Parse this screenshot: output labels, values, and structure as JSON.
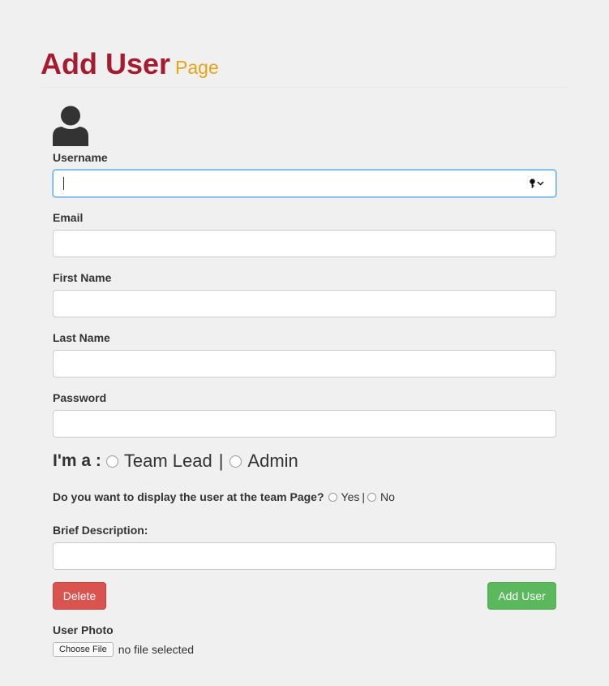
{
  "page": {
    "title_main": "Add User",
    "title_sub": "Page"
  },
  "form": {
    "username_label": "Username",
    "username_value": "",
    "email_label": "Email",
    "email_value": "",
    "firstname_label": "First Name",
    "firstname_value": "",
    "lastname_label": "Last Name",
    "lastname_value": "",
    "password_label": "Password",
    "password_value": "",
    "role_prompt": "I'm a :",
    "role_options": [
      "Team Lead",
      "Admin"
    ],
    "role_separator": "|",
    "display_prompt": "Do you want to display the user at the team Page?",
    "display_options": [
      "Yes",
      "No"
    ],
    "display_separator": "|",
    "description_label": "Brief Description:",
    "description_value": "",
    "delete_label": "Delete",
    "add_label": "Add User",
    "photo_label": "User Photo",
    "choose_file_label": "Choose File",
    "no_file_text": "no file selected"
  },
  "icons": {
    "avatar": "user-icon",
    "password_manager": "key-icon",
    "dropdown": "chevron-down-icon"
  },
  "colors": {
    "title_main": "#a51c30",
    "title_sub": "#e6a519",
    "delete": "#d9534f",
    "add": "#5cb85c",
    "focus": "#66afe9"
  }
}
